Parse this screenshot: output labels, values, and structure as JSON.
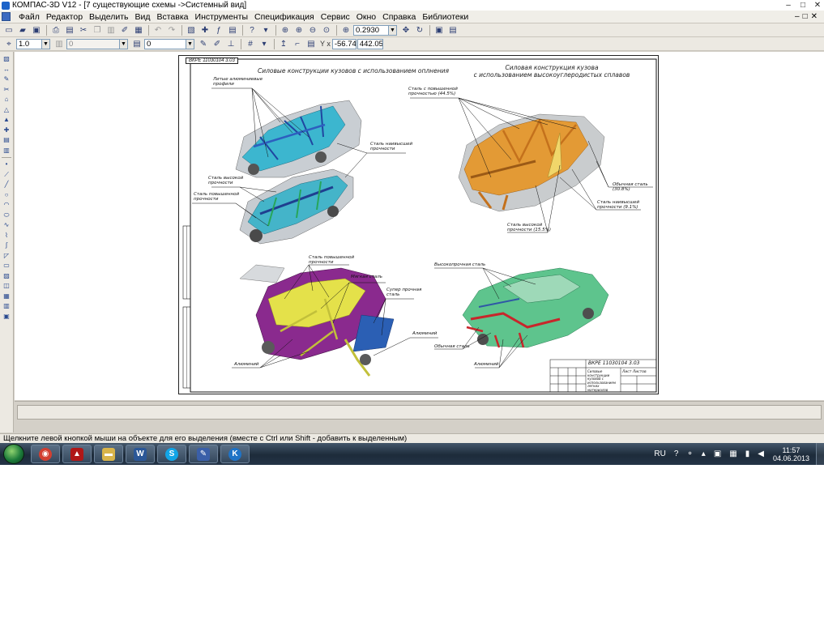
{
  "window": {
    "title": "КОМПАС-3D V12 - [7 существующие схемы ->Системный вид]",
    "controls": [
      "–",
      "□",
      "✕"
    ]
  },
  "menubar": {
    "items": [
      "Файл",
      "Редактор",
      "Выделить",
      "Вид",
      "Вставка",
      "Инструменты",
      "Спецификация",
      "Сервис",
      "Окно",
      "Справка",
      "Библиотеки"
    ],
    "mdi_controls": [
      "–",
      "□",
      "✕"
    ]
  },
  "toolbar1": {
    "zoom_value": "0.2930"
  },
  "toolbar2": {
    "line_scale": "1.0",
    "layer_value": "0",
    "style_value": "0",
    "coord_x": "-56.743",
    "coord_y": "442.058"
  },
  "drawing": {
    "sheet_code_tl": "ВКРЕ 11030104 3.03",
    "titles": {
      "q1": "Силовые конструкции кузовов с использованием оплнения",
      "q2": "Силовая конструкция кузова\nс использованием высокоуглеродистых сплавов"
    },
    "labels": {
      "q1_lit": "Литые алюминиевые\nпрофили",
      "q1_naib": "Сталь наивысшей\nпрочности",
      "q1_vys": "Сталь высокой\nпрочности",
      "q1_pov": "Сталь повышенной\nпрочности",
      "q2_pov": "Сталь с повышенной\nпрочностью (44.5%)",
      "q2_obych": "Обычная сталь (30.8%)",
      "q2_naib": "Сталь наивысшей\nпрочности (9.1%)",
      "q2_vys": "Сталь высокой\nпрочности (15.5%)",
      "q3_pov": "Сталь повышенной\nпрочности",
      "q3_myag": "Мягкая сталь",
      "q3_super": "Супер прочная\nсталь",
      "q3_alum_r": "Алюминий",
      "q3_alum_l": "Алюминий",
      "q4_vys": "Высокопрочная сталь",
      "q4_obych": "Обычная сталь",
      "q4_alum": "Алюминий"
    },
    "title_block": {
      "code": "ВКРЕ 11030104 3.03",
      "name": "Силовые конструкции кузовов с использованием легких материалов",
      "sheet_info": "Лист  Листов"
    }
  },
  "statusbar": {
    "text": "Щелкните левой кнопкой мыши на объекте для его выделения (вместе с Ctrl или Shift - добавить к выделенным)"
  },
  "taskbar": {
    "apps": [
      {
        "icon": "chrome-icon",
        "glyph": "◉",
        "color": "#d23f31"
      },
      {
        "icon": "pdf-reader-icon",
        "glyph": "▲",
        "color": "#b01717"
      },
      {
        "icon": "file-explorer-icon",
        "glyph": "▬",
        "color": "#d9b44a"
      },
      {
        "icon": "word-icon",
        "glyph": "W",
        "color": "#2b5797"
      },
      {
        "icon": "skype-icon",
        "glyph": "S",
        "color": "#12a5e6"
      },
      {
        "icon": "kompas-doc-icon",
        "glyph": "✎",
        "color": "#3a5fa8"
      },
      {
        "icon": "kompas-icon",
        "glyph": "K",
        "color": "#1f73c6"
      }
    ],
    "language": "RU",
    "time": "11:57",
    "date": "04.06.2013"
  }
}
